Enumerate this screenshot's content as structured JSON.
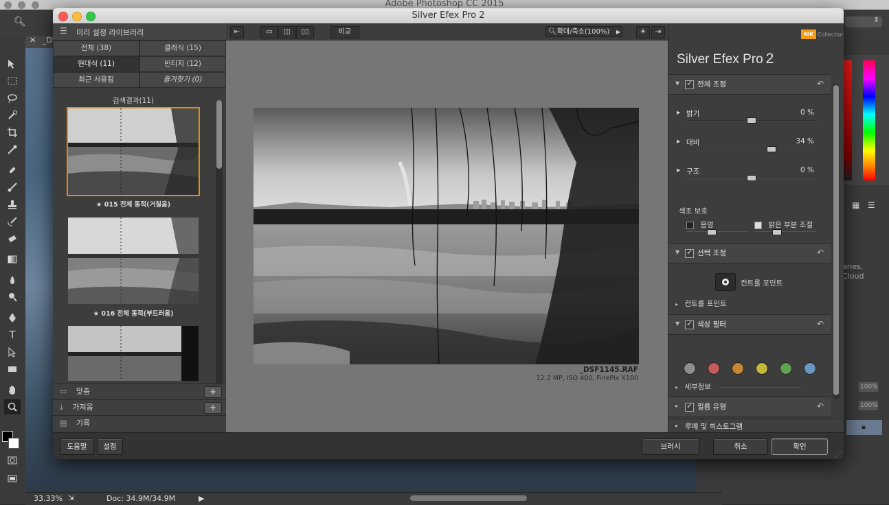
{
  "photoshop": {
    "title": "Adobe Photoshop CC 2015",
    "doc_tab": "_DSF",
    "zoom": "33.33%",
    "doc_size": "Doc: 34.9M/34.9M",
    "zoom_field_1": "100%",
    "zoom_field_2": "100%",
    "lib_text_1": "aries,",
    "lib_text_2": "Cloud"
  },
  "sep": {
    "window_title": "Silver Efex Pro 2",
    "library": {
      "header": "미리 설정 라이브러리",
      "categories": [
        {
          "label": "전체 (38)"
        },
        {
          "label": "클래식 (15)"
        },
        {
          "label": "현대식 (11)"
        },
        {
          "label": "빈티지 (12)"
        },
        {
          "label": "최근 사용됨"
        },
        {
          "label": "즐겨찾기 (0)"
        }
      ],
      "results_title": "검색결과(11)",
      "presets": [
        {
          "label": "★ 015 전체 동적(거칠음)"
        },
        {
          "label": "★ 016 전체 동적(부드러움)"
        }
      ],
      "sections": [
        {
          "label": "맞춤"
        },
        {
          "label": "가져옴"
        },
        {
          "label": "기록"
        }
      ],
      "plus": "+"
    },
    "toolbar": {
      "compare": "비교",
      "zoom": "확대/축소(100%)"
    },
    "preview": {
      "filename": "_DSF1145.RAF",
      "info": "12.2 MP, ISO 400, FinePix X100"
    },
    "right": {
      "nik": "NIK",
      "collection": "Collection",
      "brand": "Silver Efex Pro",
      "brand_num": "2",
      "global_adjust": "전체 조정",
      "brightness": {
        "label": "밝기",
        "value": "0 %"
      },
      "contrast": {
        "label": "대비",
        "value": "34 %"
      },
      "structure": {
        "label": "구조",
        "value": "0 %"
      },
      "tone_protect": "색조 보호",
      "shadows": "응영",
      "highlights": "밝은 부분 조절",
      "selective_adjust": "선택 조정",
      "control_point_btn": "컨트롤 포인트",
      "control_point_section": "컨트롤 포인트",
      "color_filter": "색상 필터",
      "filter_colors": [
        "#8e8e8e",
        "#c25a5a",
        "#c68734",
        "#c6b73a",
        "#5ea14e",
        "#6b96c1"
      ],
      "details": "세부정보",
      "film_type": "필름 유형",
      "loupe": "루페 및 히스토그램"
    },
    "bottom": {
      "help": "도움말",
      "settings": "설정",
      "brush": "브러시",
      "cancel": "취소",
      "ok": "확인"
    }
  }
}
